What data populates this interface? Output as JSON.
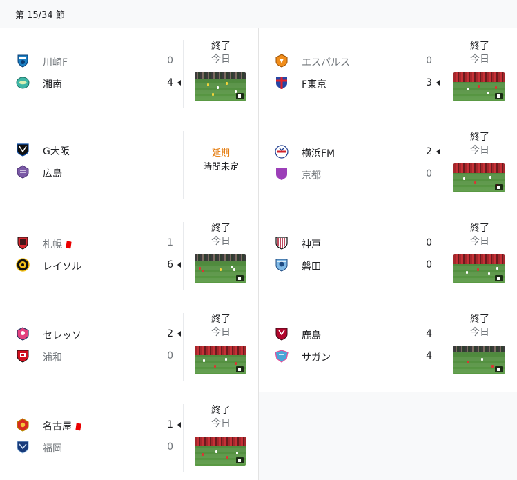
{
  "header": {
    "title": "第 15/34 節"
  },
  "status_labels": {
    "ended": "終了",
    "today": "今日",
    "postponed": "延期",
    "undecided": "時間未定"
  },
  "matches": [
    {
      "home": {
        "name": "川崎F",
        "score": "0",
        "result": "lose",
        "red_card": false,
        "logo": "kawasaki-frontale-logo"
      },
      "away": {
        "name": "湘南",
        "score": "4",
        "result": "win",
        "red_card": false,
        "logo": "shonan-bellmare-logo"
      },
      "status": "ended",
      "video": true
    },
    {
      "home": {
        "name": "エスパルス",
        "score": "0",
        "result": "lose",
        "red_card": false,
        "logo": "shimizu-spulse-logo"
      },
      "away": {
        "name": "F東京",
        "score": "3",
        "result": "win",
        "red_card": false,
        "logo": "fc-tokyo-logo"
      },
      "status": "ended",
      "video": true
    },
    {
      "home": {
        "name": "G大阪",
        "score": "",
        "result": "normal",
        "red_card": false,
        "logo": "gamba-osaka-logo"
      },
      "away": {
        "name": "広島",
        "score": "",
        "result": "normal",
        "red_card": false,
        "logo": "sanfrecce-hiroshima-logo"
      },
      "status": "postponed",
      "video": false
    },
    {
      "home": {
        "name": "横浜FM",
        "score": "2",
        "result": "win",
        "red_card": false,
        "logo": "yokohama-fmarinos-logo"
      },
      "away": {
        "name": "京都",
        "score": "0",
        "result": "lose",
        "red_card": false,
        "logo": "kyoto-sanga-logo"
      },
      "status": "ended",
      "video": true
    },
    {
      "home": {
        "name": "札幌",
        "score": "1",
        "result": "lose",
        "red_card": true,
        "logo": "consadole-sapporo-logo"
      },
      "away": {
        "name": "レイソル",
        "score": "6",
        "result": "win",
        "red_card": false,
        "logo": "kashiwa-reysol-logo"
      },
      "status": "ended",
      "video": true
    },
    {
      "home": {
        "name": "神戸",
        "score": "0",
        "result": "normal",
        "red_card": false,
        "logo": "vissel-kobe-logo"
      },
      "away": {
        "name": "磐田",
        "score": "0",
        "result": "normal",
        "red_card": false,
        "logo": "jubilo-iwata-logo"
      },
      "status": "ended",
      "video": true
    },
    {
      "home": {
        "name": "セレッソ",
        "score": "2",
        "result": "win",
        "red_card": false,
        "logo": "cerezo-osaka-logo"
      },
      "away": {
        "name": "浦和",
        "score": "0",
        "result": "lose",
        "red_card": false,
        "logo": "urawa-reds-logo"
      },
      "status": "ended",
      "video": true
    },
    {
      "home": {
        "name": "鹿島",
        "score": "4",
        "result": "normal",
        "red_card": false,
        "logo": "kashima-antlers-logo"
      },
      "away": {
        "name": "サガン",
        "score": "4",
        "result": "normal",
        "red_card": false,
        "logo": "sagan-tosu-logo"
      },
      "status": "ended",
      "video": true
    },
    {
      "home": {
        "name": "名古屋",
        "score": "1",
        "result": "win",
        "red_card": true,
        "logo": "nagoya-grampus-logo"
      },
      "away": {
        "name": "福岡",
        "score": "0",
        "result": "lose",
        "red_card": false,
        "logo": "avispa-fukuoka-logo"
      },
      "status": "ended",
      "video": true
    }
  ],
  "colors": {
    "text": "#202124",
    "muted": "#70757a",
    "postponed": "#e37400",
    "red_card": "#ea0000"
  }
}
